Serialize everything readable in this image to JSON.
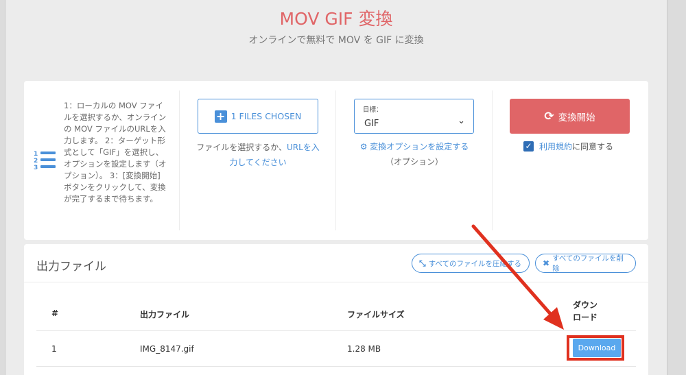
{
  "header": {
    "title": "MOV GIF 変換",
    "subtitle": "オンラインで無料で MOV を GIF に変換"
  },
  "instructions": {
    "text": "1：ローカルの MOV ファイルを選択するか、オンラインの MOV ファイルのURLを入力します。 2：ターゲット形式として「GIF」を選択し、オプションを設定します（オプション）。 3：[変換開始]ボタンをクリックして、変換が完了するまで待ちます。"
  },
  "file_select": {
    "button_label": "1 FILES CHOSEN",
    "help_prefix": "ファイルを選択するか、",
    "help_link": "URLを入力してください"
  },
  "target": {
    "label": "目標：",
    "selected": "GIF",
    "options_link": "変換オプションを設定する",
    "options_note": "（オプション）"
  },
  "convert": {
    "button_label": "変換開始",
    "terms_link": "利用規約",
    "terms_suffix": "に同意する"
  },
  "output": {
    "title": "出力ファイル",
    "compress_all": "すべてのファイルを圧縮する",
    "delete_all": "すべてのファイルを削除",
    "columns": [
      "#",
      "出力ファイル",
      "ファイルサイズ",
      "ダウンロード"
    ],
    "rows": [
      {
        "index": "1",
        "filename": "IMG_8147.gif",
        "size": "1.28 MB",
        "action": "Download"
      }
    ]
  },
  "colors": {
    "accent_red": "#e06567",
    "accent_blue": "#4a90d9",
    "annotation_red": "#e0311f"
  }
}
